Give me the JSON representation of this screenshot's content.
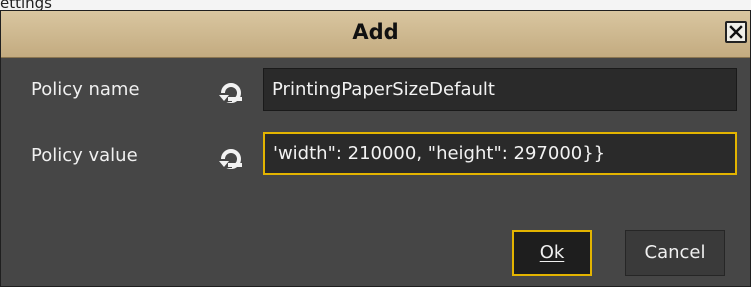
{
  "background": {
    "partial_text": "ettings"
  },
  "dialog": {
    "title": "Add",
    "close_icon": "close-icon",
    "accent_color": "#e3b400",
    "titlebar_color": "#cdb78e",
    "body_color": "#464646"
  },
  "fields": {
    "policy_name": {
      "label": "Policy name",
      "value": "PrintingPaperSizeDefault",
      "icon": "reset-icon"
    },
    "policy_value": {
      "label": "Policy value",
      "value": "'width\": 210000, \"height\": 297000}}",
      "icon": "reset-icon",
      "focused": true
    }
  },
  "buttons": {
    "ok_label": "Ok",
    "cancel_label": "Cancel"
  }
}
